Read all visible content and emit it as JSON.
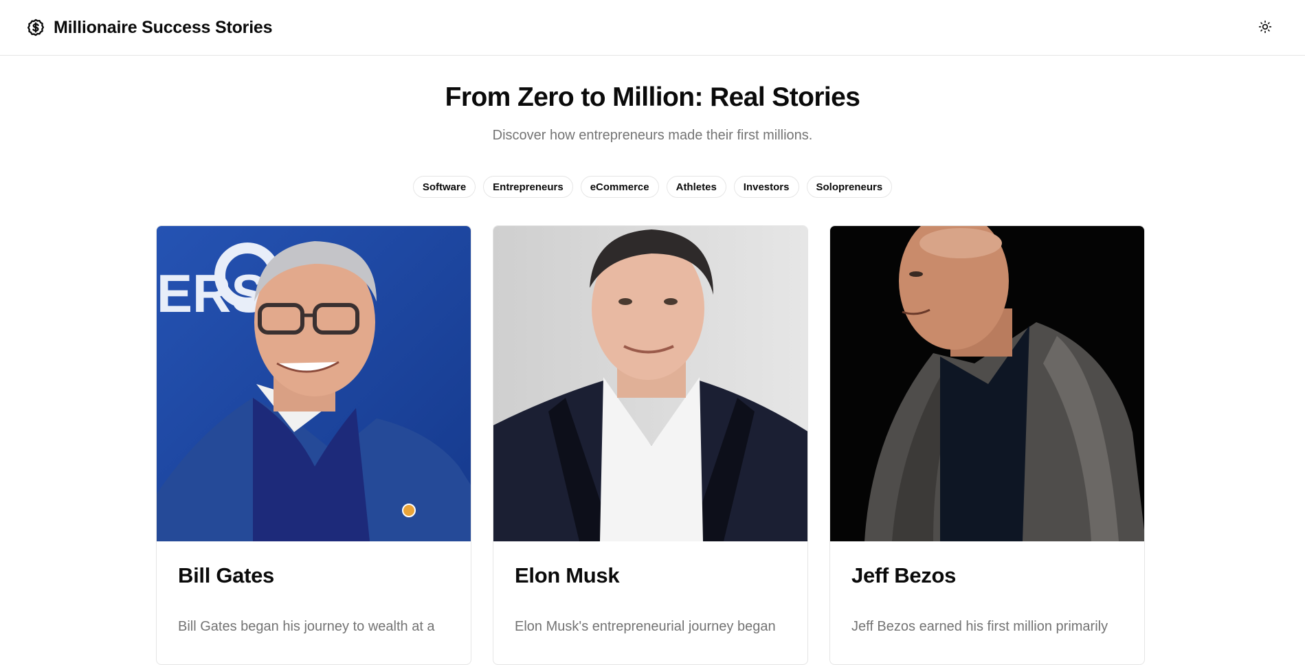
{
  "header": {
    "title": "Millionaire Success Stories",
    "logo_icon": "dollar-circle-icon",
    "theme_toggle_icon": "sun-icon"
  },
  "hero": {
    "title": "From Zero to Million: Real Stories",
    "subtitle": "Discover how entrepreneurs made their first millions."
  },
  "filters": [
    "Software",
    "Entrepreneurs",
    "eCommerce",
    "Athletes",
    "Investors",
    "Solopreneurs"
  ],
  "cards": [
    {
      "name": "Bill Gates",
      "excerpt": "Bill Gates began his journey to wealth at a",
      "photo_bg": "#1f4aa8"
    },
    {
      "name": "Elon Musk",
      "excerpt": "Elon Musk's entrepreneurial journey began",
      "photo_bg": "#dcdcdc"
    },
    {
      "name": "Jeff Bezos",
      "excerpt": "Jeff Bezos earned his first million primarily",
      "photo_bg": "#050505"
    }
  ],
  "colors": {
    "text": "#0a0a0a",
    "muted": "#737373",
    "border": "#e5e5e5"
  }
}
